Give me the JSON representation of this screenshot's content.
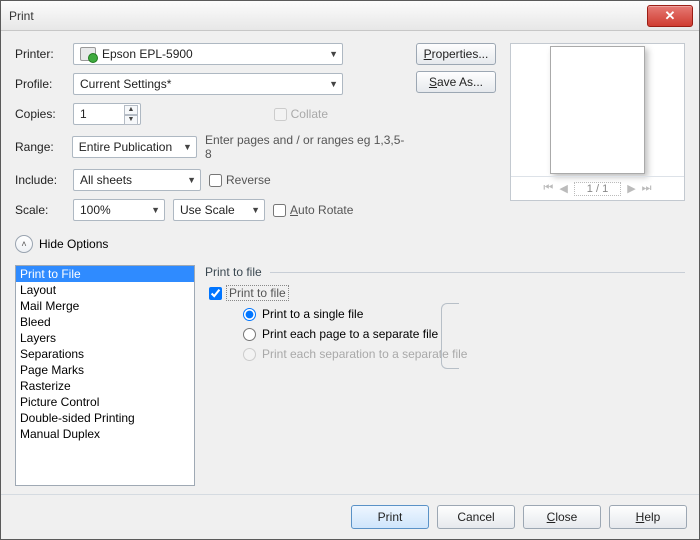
{
  "window": {
    "title": "Print"
  },
  "labels": {
    "printer": "Printer:",
    "profile": "Profile:",
    "copies": "Copies:",
    "range": "Range:",
    "include": "Include:",
    "scale": "Scale:"
  },
  "form": {
    "printer": "Epson EPL-5900",
    "profile": "Current Settings*",
    "copies": "1",
    "range": "Entire Publication",
    "include": "All sheets",
    "scale": "100%",
    "scale_mode": "Use Scale"
  },
  "checks": {
    "collate": "Collate",
    "reverse": "Reverse",
    "auto_rotate": "Auto Rotate"
  },
  "hint": {
    "range": "Enter pages and / or ranges eg 1,3,5-8"
  },
  "buttons": {
    "properties": "Properties...",
    "saveas": "Save As..."
  },
  "pager": {
    "info": "1 / 1"
  },
  "hide_options": "Hide Options",
  "options": {
    "items": [
      "Print to File",
      "Layout",
      "Mail Merge",
      "Bleed",
      "Layers",
      "Separations",
      "Page Marks",
      "Rasterize",
      "Picture Control",
      "Double-sided Printing",
      "Manual Duplex"
    ]
  },
  "panel": {
    "title": "Print to file",
    "ptf": "Print to file",
    "r1": "Print to a single file",
    "r2": "Print each page to a separate file",
    "r3": "Print each separation to a separate file"
  },
  "footer": {
    "print": "Print",
    "cancel": "Cancel",
    "close": "Close",
    "help": "Help"
  }
}
